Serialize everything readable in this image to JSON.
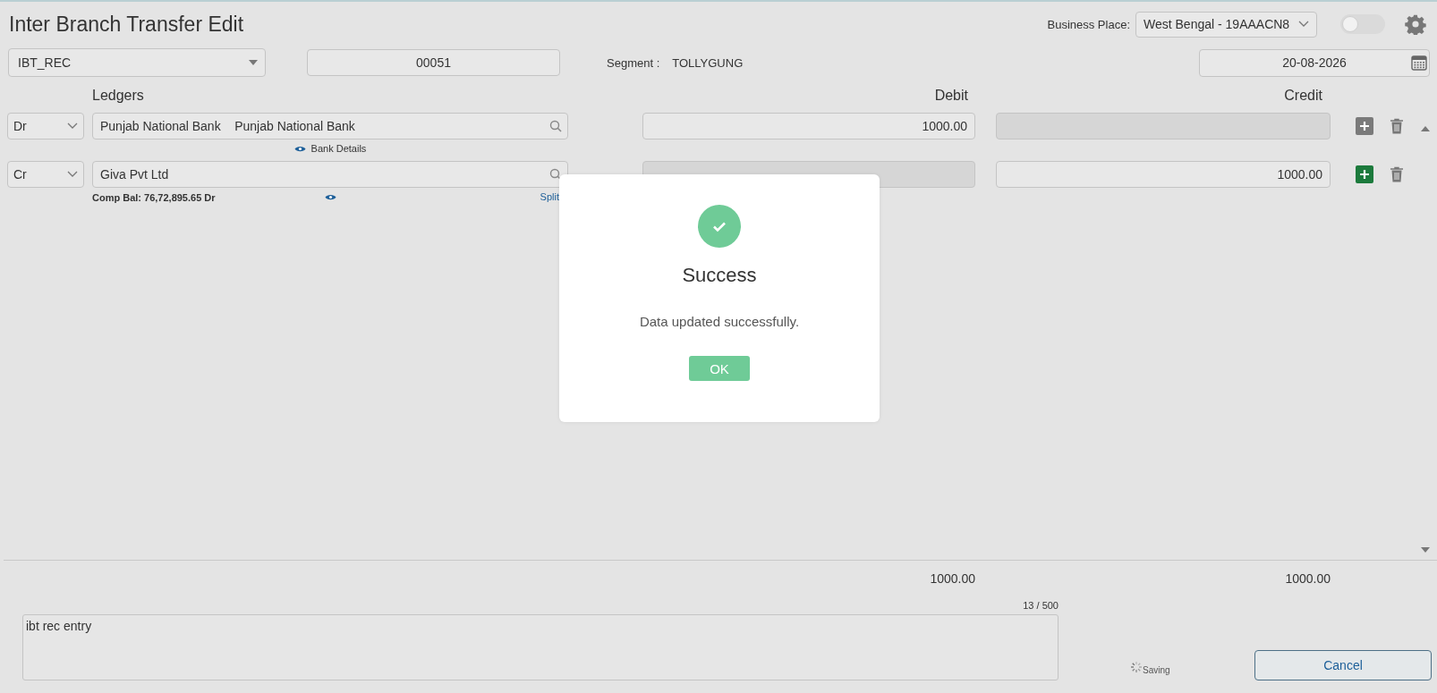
{
  "window": {
    "title": "Inter Branch Transfer Edit"
  },
  "business_place": {
    "label": "Business Place:",
    "value": "West Bengal - 19AAACN8"
  },
  "toggle": {
    "on": false
  },
  "header": {
    "voucher_type": "IBT_REC",
    "voucher_number": "00051",
    "segment_label": "Segment :",
    "segment_value": "TOLLYGUNG",
    "date": "20-08-2026"
  },
  "columns": {
    "ledgers": "Ledgers",
    "debit": "Debit",
    "credit": "Credit"
  },
  "lines": [
    {
      "side": "Dr",
      "ledger": "Punjab National Bank    Punjab National Bank",
      "debit": {
        "value": "1000.00",
        "disabled": false
      },
      "credit": {
        "disabled": true
      },
      "details_label": "Bank Details",
      "add_highlighted": false
    },
    {
      "side": "Cr",
      "ledger": "Giva Pvt Ltd",
      "debit": {
        "disabled": true
      },
      "credit": {
        "value": "1000.00",
        "disabled": false
      },
      "comp_balance": "Comp Bal: 76,72,895.65 Dr",
      "split_label": "Split",
      "add_highlighted": true
    }
  ],
  "totals": {
    "debit": "1000.00",
    "credit": "1000.00"
  },
  "narration": {
    "value": "ibt rec entry",
    "counter": "13 / 500"
  },
  "status": "Saving",
  "cancel_button": "Cancel",
  "dialog": {
    "title": "Success",
    "message": "Data updated successfully.",
    "button": "OK"
  }
}
